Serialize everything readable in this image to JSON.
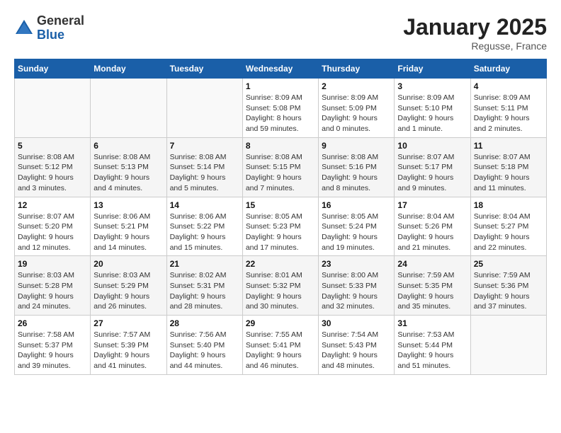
{
  "header": {
    "logo_general": "General",
    "logo_blue": "Blue",
    "month_title": "January 2025",
    "location": "Regusse, France"
  },
  "days_of_week": [
    "Sunday",
    "Monday",
    "Tuesday",
    "Wednesday",
    "Thursday",
    "Friday",
    "Saturday"
  ],
  "weeks": [
    [
      {
        "day": "",
        "sunrise": "",
        "sunset": "",
        "daylight": ""
      },
      {
        "day": "",
        "sunrise": "",
        "sunset": "",
        "daylight": ""
      },
      {
        "day": "",
        "sunrise": "",
        "sunset": "",
        "daylight": ""
      },
      {
        "day": "1",
        "sunrise": "Sunrise: 8:09 AM",
        "sunset": "Sunset: 5:08 PM",
        "daylight": "Daylight: 8 hours and 59 minutes."
      },
      {
        "day": "2",
        "sunrise": "Sunrise: 8:09 AM",
        "sunset": "Sunset: 5:09 PM",
        "daylight": "Daylight: 9 hours and 0 minutes."
      },
      {
        "day": "3",
        "sunrise": "Sunrise: 8:09 AM",
        "sunset": "Sunset: 5:10 PM",
        "daylight": "Daylight: 9 hours and 1 minute."
      },
      {
        "day": "4",
        "sunrise": "Sunrise: 8:09 AM",
        "sunset": "Sunset: 5:11 PM",
        "daylight": "Daylight: 9 hours and 2 minutes."
      }
    ],
    [
      {
        "day": "5",
        "sunrise": "Sunrise: 8:08 AM",
        "sunset": "Sunset: 5:12 PM",
        "daylight": "Daylight: 9 hours and 3 minutes."
      },
      {
        "day": "6",
        "sunrise": "Sunrise: 8:08 AM",
        "sunset": "Sunset: 5:13 PM",
        "daylight": "Daylight: 9 hours and 4 minutes."
      },
      {
        "day": "7",
        "sunrise": "Sunrise: 8:08 AM",
        "sunset": "Sunset: 5:14 PM",
        "daylight": "Daylight: 9 hours and 5 minutes."
      },
      {
        "day": "8",
        "sunrise": "Sunrise: 8:08 AM",
        "sunset": "Sunset: 5:15 PM",
        "daylight": "Daylight: 9 hours and 7 minutes."
      },
      {
        "day": "9",
        "sunrise": "Sunrise: 8:08 AM",
        "sunset": "Sunset: 5:16 PM",
        "daylight": "Daylight: 9 hours and 8 minutes."
      },
      {
        "day": "10",
        "sunrise": "Sunrise: 8:07 AM",
        "sunset": "Sunset: 5:17 PM",
        "daylight": "Daylight: 9 hours and 9 minutes."
      },
      {
        "day": "11",
        "sunrise": "Sunrise: 8:07 AM",
        "sunset": "Sunset: 5:18 PM",
        "daylight": "Daylight: 9 hours and 11 minutes."
      }
    ],
    [
      {
        "day": "12",
        "sunrise": "Sunrise: 8:07 AM",
        "sunset": "Sunset: 5:20 PM",
        "daylight": "Daylight: 9 hours and 12 minutes."
      },
      {
        "day": "13",
        "sunrise": "Sunrise: 8:06 AM",
        "sunset": "Sunset: 5:21 PM",
        "daylight": "Daylight: 9 hours and 14 minutes."
      },
      {
        "day": "14",
        "sunrise": "Sunrise: 8:06 AM",
        "sunset": "Sunset: 5:22 PM",
        "daylight": "Daylight: 9 hours and 15 minutes."
      },
      {
        "day": "15",
        "sunrise": "Sunrise: 8:05 AM",
        "sunset": "Sunset: 5:23 PM",
        "daylight": "Daylight: 9 hours and 17 minutes."
      },
      {
        "day": "16",
        "sunrise": "Sunrise: 8:05 AM",
        "sunset": "Sunset: 5:24 PM",
        "daylight": "Daylight: 9 hours and 19 minutes."
      },
      {
        "day": "17",
        "sunrise": "Sunrise: 8:04 AM",
        "sunset": "Sunset: 5:26 PM",
        "daylight": "Daylight: 9 hours and 21 minutes."
      },
      {
        "day": "18",
        "sunrise": "Sunrise: 8:04 AM",
        "sunset": "Sunset: 5:27 PM",
        "daylight": "Daylight: 9 hours and 22 minutes."
      }
    ],
    [
      {
        "day": "19",
        "sunrise": "Sunrise: 8:03 AM",
        "sunset": "Sunset: 5:28 PM",
        "daylight": "Daylight: 9 hours and 24 minutes."
      },
      {
        "day": "20",
        "sunrise": "Sunrise: 8:03 AM",
        "sunset": "Sunset: 5:29 PM",
        "daylight": "Daylight: 9 hours and 26 minutes."
      },
      {
        "day": "21",
        "sunrise": "Sunrise: 8:02 AM",
        "sunset": "Sunset: 5:31 PM",
        "daylight": "Daylight: 9 hours and 28 minutes."
      },
      {
        "day": "22",
        "sunrise": "Sunrise: 8:01 AM",
        "sunset": "Sunset: 5:32 PM",
        "daylight": "Daylight: 9 hours and 30 minutes."
      },
      {
        "day": "23",
        "sunrise": "Sunrise: 8:00 AM",
        "sunset": "Sunset: 5:33 PM",
        "daylight": "Daylight: 9 hours and 32 minutes."
      },
      {
        "day": "24",
        "sunrise": "Sunrise: 7:59 AM",
        "sunset": "Sunset: 5:35 PM",
        "daylight": "Daylight: 9 hours and 35 minutes."
      },
      {
        "day": "25",
        "sunrise": "Sunrise: 7:59 AM",
        "sunset": "Sunset: 5:36 PM",
        "daylight": "Daylight: 9 hours and 37 minutes."
      }
    ],
    [
      {
        "day": "26",
        "sunrise": "Sunrise: 7:58 AM",
        "sunset": "Sunset: 5:37 PM",
        "daylight": "Daylight: 9 hours and 39 minutes."
      },
      {
        "day": "27",
        "sunrise": "Sunrise: 7:57 AM",
        "sunset": "Sunset: 5:39 PM",
        "daylight": "Daylight: 9 hours and 41 minutes."
      },
      {
        "day": "28",
        "sunrise": "Sunrise: 7:56 AM",
        "sunset": "Sunset: 5:40 PM",
        "daylight": "Daylight: 9 hours and 44 minutes."
      },
      {
        "day": "29",
        "sunrise": "Sunrise: 7:55 AM",
        "sunset": "Sunset: 5:41 PM",
        "daylight": "Daylight: 9 hours and 46 minutes."
      },
      {
        "day": "30",
        "sunrise": "Sunrise: 7:54 AM",
        "sunset": "Sunset: 5:43 PM",
        "daylight": "Daylight: 9 hours and 48 minutes."
      },
      {
        "day": "31",
        "sunrise": "Sunrise: 7:53 AM",
        "sunset": "Sunset: 5:44 PM",
        "daylight": "Daylight: 9 hours and 51 minutes."
      },
      {
        "day": "",
        "sunrise": "",
        "sunset": "",
        "daylight": ""
      }
    ]
  ]
}
